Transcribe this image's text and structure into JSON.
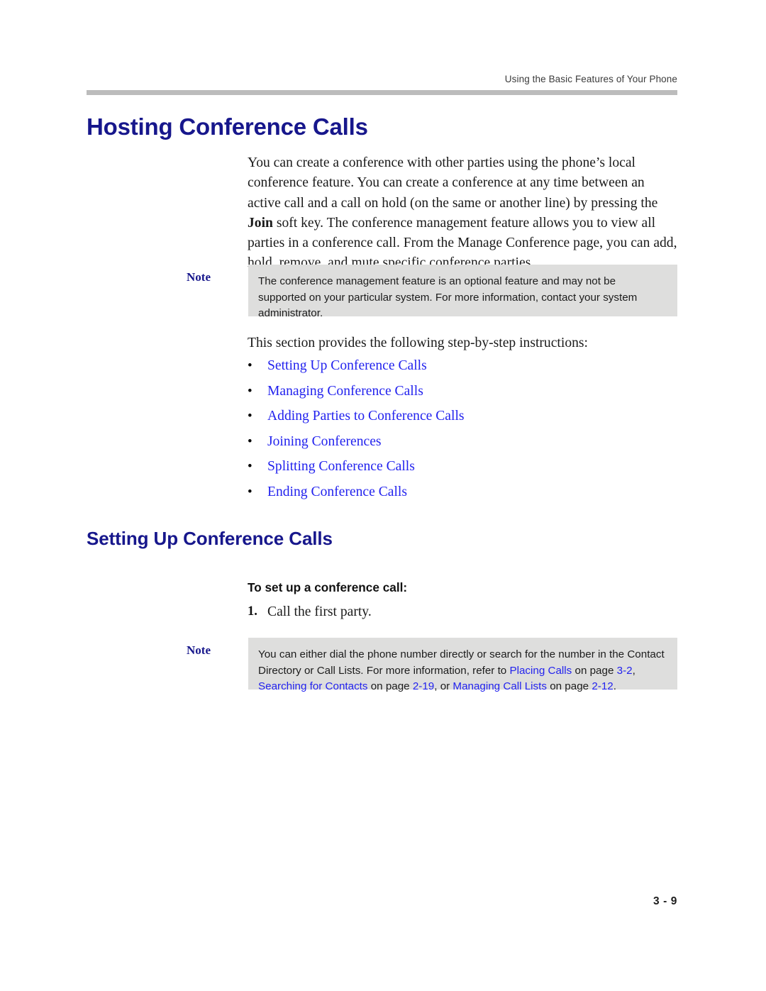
{
  "header": {
    "running_head": "Using the Basic Features of Your Phone"
  },
  "chapter_title": "Hosting Conference Calls",
  "intro_paragraph": {
    "part1": "You can create a conference with other parties using the phone’s local conference feature. You can create a conference at any time between an active call and a call on hold (on the same or another line) by pressing the ",
    "bold_term": "Join",
    "part2": " soft key. The conference management feature allows you to view all parties in a conference call. From the Manage Conference page, you can add, hold, remove, and mute specific conference parties."
  },
  "note1": {
    "label": "Note",
    "text": "The conference management feature is an optional feature and may not be supported on your particular system. For more information, contact your system administrator."
  },
  "intro_list_line": "This section provides the following step-by-step instructions:",
  "bullet_marker": "•",
  "bullets": [
    {
      "label": "Setting Up Conference Calls"
    },
    {
      "label": "Managing Conference Calls"
    },
    {
      "label": "Adding Parties to Conference Calls"
    },
    {
      "label": "Joining Conferences"
    },
    {
      "label": "Splitting Conference Calls"
    },
    {
      "label": "Ending Conference Calls"
    }
  ],
  "section": {
    "heading": "Setting Up Conference Calls",
    "procedure_title": "To set up a conference call:",
    "step1_number": "1.",
    "step1_text": "Call the first party."
  },
  "note2": {
    "label": "Note",
    "t1": "You can either dial the phone number directly or search for the number in the Contact Directory or Call Lists. For more information, refer to ",
    "link1": "Placing Calls",
    "t2": " on page ",
    "link2": "3-2",
    "t3": ", ",
    "link3": "Searching for Contacts",
    "t4": " on page ",
    "link4": "2-19",
    "t5": ", or ",
    "link5": "Managing Call Lists",
    "t6": " on page ",
    "link6": "2-12",
    "t7": "."
  },
  "folio": "3 - 9",
  "colors": {
    "heading_navy": "#17178c",
    "link_blue": "#2222ee",
    "note_bg": "#dededd",
    "rule_gray": "#bcbcbc"
  }
}
